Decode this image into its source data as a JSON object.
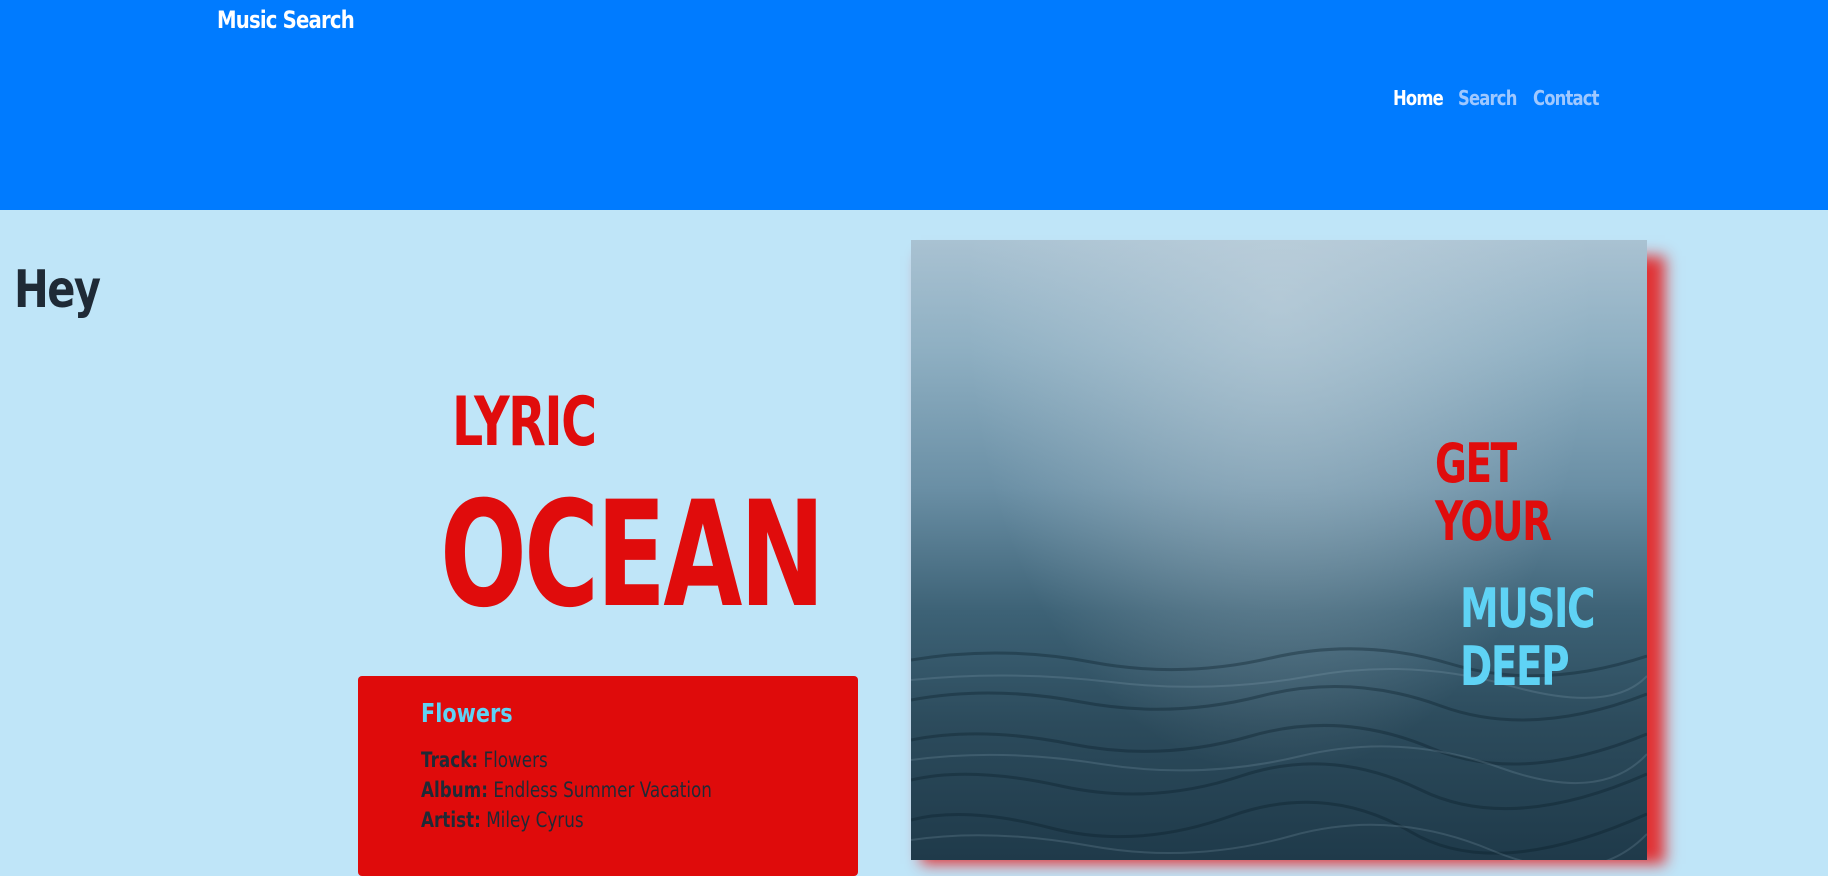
{
  "navbar": {
    "brand": "Music Search",
    "links": [
      "Home",
      "Search",
      "Contact"
    ],
    "active": "Home"
  },
  "main": {
    "greeting": "Hey",
    "lyric_label": "LYRIC",
    "ocean_label": "OCEAN"
  },
  "song": {
    "title": "Flowers",
    "track_label": "Track:",
    "track_value": "Flowers",
    "album_label": "Album:",
    "album_value": "Endless Summer Vacation",
    "artist_label": "Artist:",
    "artist_value": "Miley Cyrus"
  },
  "hero": {
    "line1": "GET",
    "line2": "YOUR",
    "line3": "MUSIC",
    "line4": "DEEP"
  },
  "colors": {
    "navbar": "#007bff",
    "page_background": "#bfe5f8",
    "accent_red": "#e00c0c",
    "accent_cyan": "#5fd3f5"
  }
}
